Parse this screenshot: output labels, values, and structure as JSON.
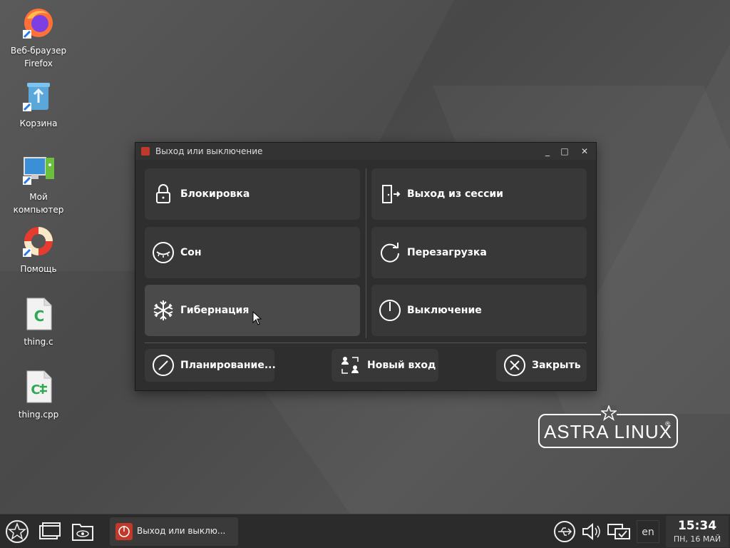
{
  "desktop": {
    "icons": [
      {
        "label_line1": "Веб-браузер",
        "label_line2": "Firefox",
        "icon": "firefox-icon"
      },
      {
        "label_line1": "Корзина",
        "label_line2": "",
        "icon": "trash-icon"
      },
      {
        "label_line1": "Мой",
        "label_line2": "компьютер",
        "icon": "computer-icon"
      },
      {
        "label_line1": "Помощь",
        "label_line2": "",
        "icon": "lifebuoy-icon"
      },
      {
        "label_line1": "thing.c",
        "label_line2": "",
        "icon": "c-file-icon"
      },
      {
        "label_line1": "thing.cpp",
        "label_line2": "",
        "icon": "cpp-file-icon"
      }
    ],
    "logo_text": "ASTRA LINUX",
    "logo_reg": "®"
  },
  "dialog": {
    "title": "Выход или выключение",
    "minimize": "_",
    "maximize": "□",
    "close": "✕",
    "actions": {
      "lock": "Блокировка",
      "logout": "Выход из сессии",
      "sleep": "Сон",
      "reboot": "Перезагрузка",
      "hibernate": "Гибернация",
      "shutdown": "Выключение"
    },
    "bottom": {
      "schedule": "Планирование...",
      "new_login": "Новый вход",
      "close": "Закрыть"
    }
  },
  "taskbar": {
    "task_title": "Выход или выклю...",
    "lang": "en",
    "time": "15:34",
    "date": "ПН, 16 МАЙ"
  },
  "colors": {
    "accent": "#c0392b",
    "dialog_bg": "#2e2e2e",
    "button_bg": "#383838",
    "button_hover": "#4a4a4a"
  }
}
